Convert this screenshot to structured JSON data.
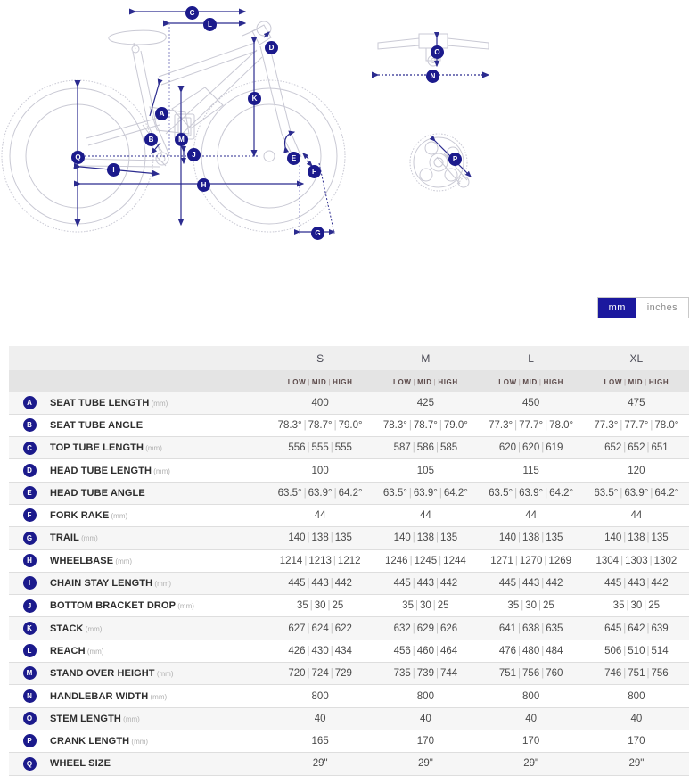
{
  "units": {
    "mm_label": "mm",
    "inches_label": "inches",
    "selected": "mm"
  },
  "diagram": {
    "callouts": [
      "A",
      "B",
      "C",
      "D",
      "E",
      "F",
      "G",
      "H",
      "I",
      "J",
      "K",
      "L",
      "M",
      "N",
      "O",
      "P",
      "Q"
    ],
    "side_view_labels": [
      "C",
      "L",
      "D",
      "K",
      "A",
      "B",
      "M",
      "J",
      "E",
      "F",
      "I",
      "H",
      "Q",
      "G"
    ],
    "handlebar_labels": [
      "O",
      "N"
    ],
    "crank_labels": [
      "P"
    ]
  },
  "table": {
    "sizes": [
      "S",
      "M",
      "L",
      "XL"
    ],
    "variant_labels": [
      "LOW",
      "MID",
      "HIGH"
    ],
    "rows": [
      {
        "badge": "A",
        "label": "SEAT TUBE LENGTH",
        "unit": "(mm)",
        "values": [
          [
            "400"
          ],
          [
            "425"
          ],
          [
            "450"
          ],
          [
            "475"
          ]
        ]
      },
      {
        "badge": "B",
        "label": "SEAT TUBE ANGLE",
        "unit": "",
        "values": [
          [
            "78.3°",
            "78.7°",
            "79.0°"
          ],
          [
            "78.3°",
            "78.7°",
            "79.0°"
          ],
          [
            "77.3°",
            "77.7°",
            "78.0°"
          ],
          [
            "77.3°",
            "77.7°",
            "78.0°"
          ]
        ]
      },
      {
        "badge": "C",
        "label": "TOP TUBE LENGTH",
        "unit": "(mm)",
        "values": [
          [
            "556",
            "555",
            "555"
          ],
          [
            "587",
            "586",
            "585"
          ],
          [
            "620",
            "620",
            "619"
          ],
          [
            "652",
            "652",
            "651"
          ]
        ]
      },
      {
        "badge": "D",
        "label": "HEAD TUBE LENGTH",
        "unit": "(mm)",
        "values": [
          [
            "100"
          ],
          [
            "105"
          ],
          [
            "115"
          ],
          [
            "120"
          ]
        ]
      },
      {
        "badge": "E",
        "label": "HEAD TUBE ANGLE",
        "unit": "",
        "values": [
          [
            "63.5°",
            "63.9°",
            "64.2°"
          ],
          [
            "63.5°",
            "63.9°",
            "64.2°"
          ],
          [
            "63.5°",
            "63.9°",
            "64.2°"
          ],
          [
            "63.5°",
            "63.9°",
            "64.2°"
          ]
        ]
      },
      {
        "badge": "F",
        "label": "FORK RAKE",
        "unit": "(mm)",
        "values": [
          [
            "44"
          ],
          [
            "44"
          ],
          [
            "44"
          ],
          [
            "44"
          ]
        ]
      },
      {
        "badge": "G",
        "label": "TRAIL",
        "unit": "(mm)",
        "values": [
          [
            "140",
            "138",
            "135"
          ],
          [
            "140",
            "138",
            "135"
          ],
          [
            "140",
            "138",
            "135"
          ],
          [
            "140",
            "138",
            "135"
          ]
        ]
      },
      {
        "badge": "H",
        "label": "WHEELBASE",
        "unit": "(mm)",
        "values": [
          [
            "1214",
            "1213",
            "1212"
          ],
          [
            "1246",
            "1245",
            "1244"
          ],
          [
            "1271",
            "1270",
            "1269"
          ],
          [
            "1304",
            "1303",
            "1302"
          ]
        ]
      },
      {
        "badge": "I",
        "label": "CHAIN STAY LENGTH",
        "unit": "(mm)",
        "values": [
          [
            "445",
            "443",
            "442"
          ],
          [
            "445",
            "443",
            "442"
          ],
          [
            "445",
            "443",
            "442"
          ],
          [
            "445",
            "443",
            "442"
          ]
        ]
      },
      {
        "badge": "J",
        "label": "BOTTOM BRACKET DROP",
        "unit": "(mm)",
        "values": [
          [
            "35",
            "30",
            "25"
          ],
          [
            "35",
            "30",
            "25"
          ],
          [
            "35",
            "30",
            "25"
          ],
          [
            "35",
            "30",
            "25"
          ]
        ]
      },
      {
        "badge": "K",
        "label": "STACK",
        "unit": "(mm)",
        "values": [
          [
            "627",
            "624",
            "622"
          ],
          [
            "632",
            "629",
            "626"
          ],
          [
            "641",
            "638",
            "635"
          ],
          [
            "645",
            "642",
            "639"
          ]
        ]
      },
      {
        "badge": "L",
        "label": "REACH",
        "unit": "(mm)",
        "values": [
          [
            "426",
            "430",
            "434"
          ],
          [
            "456",
            "460",
            "464"
          ],
          [
            "476",
            "480",
            "484"
          ],
          [
            "506",
            "510",
            "514"
          ]
        ]
      },
      {
        "badge": "M",
        "label": "STAND OVER HEIGHT",
        "unit": "(mm)",
        "values": [
          [
            "720",
            "724",
            "729"
          ],
          [
            "735",
            "739",
            "744"
          ],
          [
            "751",
            "756",
            "760"
          ],
          [
            "746",
            "751",
            "756"
          ]
        ]
      },
      {
        "badge": "N",
        "label": "HANDLEBAR WIDTH",
        "unit": "(mm)",
        "values": [
          [
            "800"
          ],
          [
            "800"
          ],
          [
            "800"
          ],
          [
            "800"
          ]
        ]
      },
      {
        "badge": "O",
        "label": "STEM LENGTH",
        "unit": "(mm)",
        "values": [
          [
            "40"
          ],
          [
            "40"
          ],
          [
            "40"
          ],
          [
            "40"
          ]
        ]
      },
      {
        "badge": "P",
        "label": "CRANK LENGTH",
        "unit": "(mm)",
        "values": [
          [
            "165"
          ],
          [
            "170"
          ],
          [
            "170"
          ],
          [
            "170"
          ]
        ]
      },
      {
        "badge": "Q",
        "label": "WHEEL SIZE",
        "unit": "",
        "values": [
          [
            "29\""
          ],
          [
            "29\""
          ],
          [
            "29\""
          ],
          [
            "29\""
          ]
        ]
      }
    ]
  },
  "colors": {
    "accent_navy": "#1b1a8c",
    "toggle_active": "#1b189e",
    "diagram_line": "#c9c9d4",
    "dimension_line": "#2b2b8f",
    "header_bg": "#efefef",
    "subheader_bg": "#e4e4e4",
    "row_odd": "#f6f6f6"
  }
}
